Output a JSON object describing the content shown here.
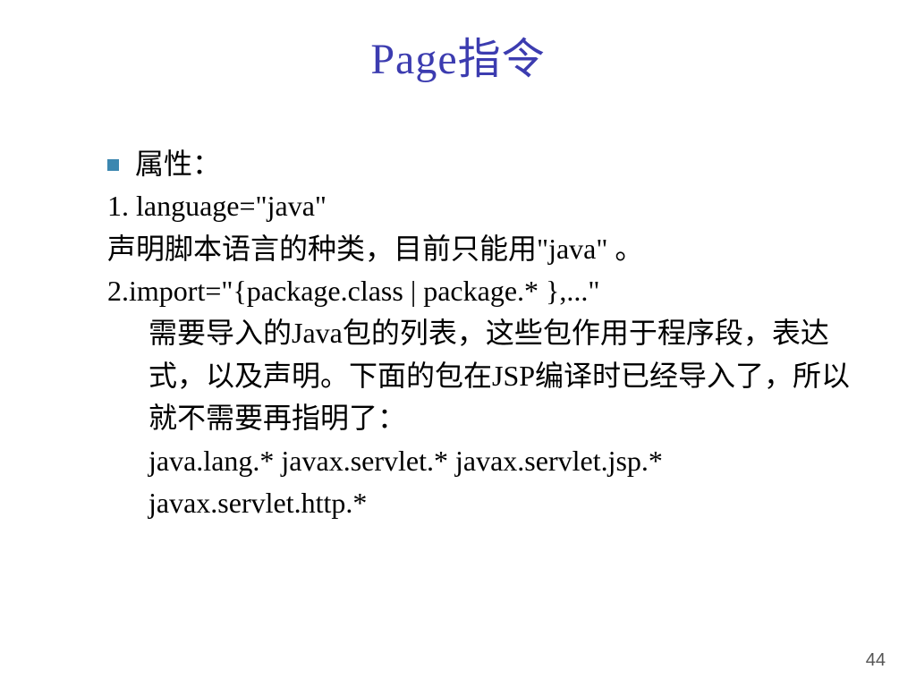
{
  "title": "Page指令",
  "bullet_label": "属性：",
  "line1": "1. language=\"java\"",
  "line2": "声明脚本语言的种类，目前只能用\"java\" 。",
  "line3": "2.import=\"{package.class | package.* },...\"",
  "line4": "需要导入的Java包的列表，这些包作用于程序段，表达式，以及声明。下面的包在JSP编译时已经导入了，所以就不需要再指明了：",
  "line5": "java.lang.* javax.servlet.* javax.servlet.jsp.* javax.servlet.http.*",
  "page_number": "44"
}
